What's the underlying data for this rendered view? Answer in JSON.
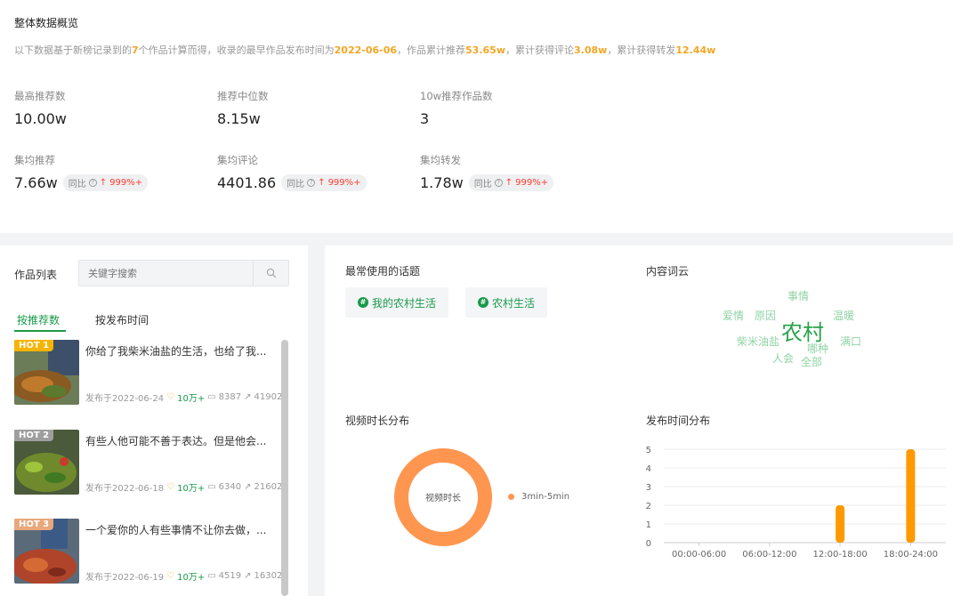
{
  "overview": {
    "title": "整体数据概览",
    "summary": {
      "p1": "以下数据基于新榜记录到的",
      "count": "7",
      "p2": "个作品计算而得，收录的最早作品发布时间为",
      "date": "2022-06-06",
      "p3": "，作品累计推荐",
      "rec": "53.65w",
      "p4": "，累计获得评论",
      "comments": "3.08w",
      "p5": "，累计获得转发",
      "shares": "12.44w"
    },
    "metrics": [
      {
        "label": "最高推荐数",
        "value": "10.00w"
      },
      {
        "label": "推荐中位数",
        "value": "8.15w"
      },
      {
        "label": "10w推荐作品数",
        "value": "3"
      },
      {
        "label": "集均推荐",
        "value": "7.66w",
        "yoy_label": "同比",
        "yoy_value": "999%+"
      },
      {
        "label": "集均评论",
        "value": "4401.86",
        "yoy_label": "同比",
        "yoy_value": "999%+"
      },
      {
        "label": "集均转发",
        "value": "1.78w",
        "yoy_label": "同比",
        "yoy_value": "999%+"
      }
    ]
  },
  "works": {
    "title": "作品列表",
    "search_placeholder": "关键字搜索",
    "tabs": [
      "按推荐数",
      "按发布时间"
    ],
    "items": [
      {
        "badge": "HOT 1",
        "badge_color": "#f5b400",
        "title": "你给了我柴米油盐的生活，也给了我...",
        "date": "发布于2022-06-24",
        "likes": "10万+",
        "comments": "8387",
        "shares": "41902"
      },
      {
        "badge": "HOT 2",
        "badge_color": "#9e9e9e",
        "title": "有些人他可能不善于表达。但是他会...",
        "date": "发布于2022-06-18",
        "likes": "10万+",
        "comments": "6340",
        "shares": "21602"
      },
      {
        "badge": "HOT 3",
        "badge_color": "#e8a87c",
        "title": "一个爱你的人有些事情不让你去做，...",
        "date": "发布于2022-06-19",
        "likes": "10万+",
        "comments": "4519",
        "shares": "16302"
      }
    ]
  },
  "topics": {
    "title": "最常使用的话题",
    "items": [
      "我的农村生活",
      "农村生活"
    ]
  },
  "wordcloud": {
    "title": "内容词云",
    "words": [
      "事情",
      "爱情",
      "原因",
      "农村",
      "温暖",
      "柴米油盐",
      "哪种",
      "满口",
      "人会",
      "全部"
    ]
  },
  "duration": {
    "title": "视频时长分布",
    "center_label": "视频时长",
    "legend": "3min-5min",
    "color": "#ff9650"
  },
  "publish": {
    "title": "发布时间分布"
  },
  "chart_data": {
    "type": "bar",
    "categories": [
      "00:00-06:00",
      "06:00-12:00",
      "12:00-18:00",
      "18:00-24:00"
    ],
    "values": [
      0,
      0,
      2,
      5
    ],
    "ylim": [
      0,
      5
    ],
    "yticks": [
      0,
      1,
      2,
      3,
      4,
      5
    ],
    "color": "#ff9900",
    "grid": true
  }
}
